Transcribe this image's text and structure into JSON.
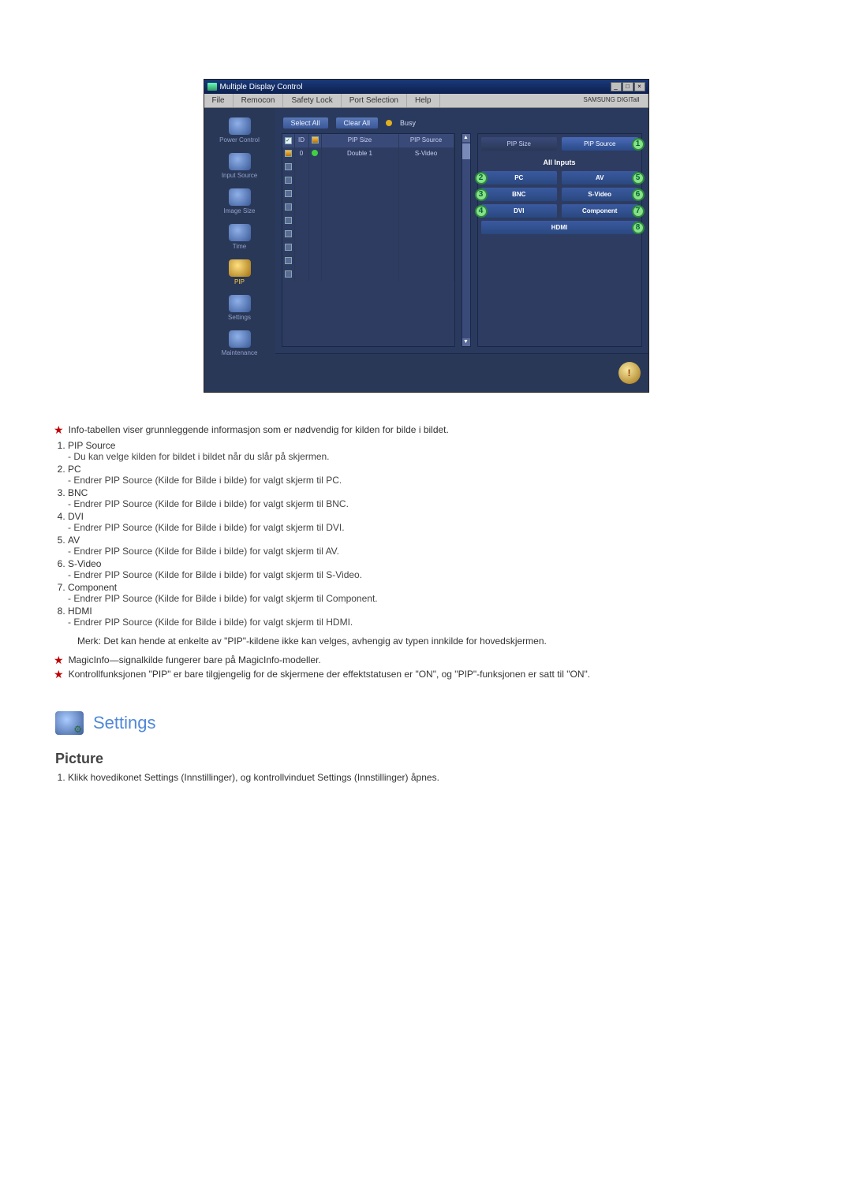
{
  "app": {
    "title": "Multiple Display Control",
    "menus": [
      "File",
      "Remocon",
      "Safety Lock",
      "Port Selection",
      "Help"
    ],
    "brand": "SAMSUNG DIGITall"
  },
  "sidebar": {
    "items": [
      {
        "label": "Power Control"
      },
      {
        "label": "Input Source"
      },
      {
        "label": "Image Size"
      },
      {
        "label": "Time"
      },
      {
        "label": "PIP",
        "active": true
      },
      {
        "label": "Settings"
      },
      {
        "label": "Maintenance"
      }
    ]
  },
  "toolbar": {
    "select_all": "Select All",
    "clear_all": "Clear All",
    "busy": "Busy"
  },
  "table": {
    "headers": {
      "chk": "",
      "id": "ID",
      "status": "",
      "size": "PIP Size",
      "source": "PIP Source"
    },
    "row0": {
      "id": "0",
      "size": "Double 1",
      "source": "S-Video"
    }
  },
  "panel": {
    "top_tabs": {
      "size": "PIP Size",
      "source": "PIP Source"
    },
    "all_inputs": "All Inputs",
    "buttons": {
      "pc": "PC",
      "av": "AV",
      "bnc": "BNC",
      "svideo": "S-Video",
      "dvi": "DVI",
      "component": "Component",
      "hdmi": "HDMI"
    },
    "callouts": {
      "c1": "1",
      "c2": "2",
      "c3": "3",
      "c4": "4",
      "c5": "5",
      "c6": "6",
      "c7": "7",
      "c8": "8"
    }
  },
  "explain": {
    "intro": "Info-tabellen viser grunnleggende informasjon som er nødvendig for kilden for bilde i bildet.",
    "items": [
      {
        "h": "PIP Source",
        "d": "- Du kan velge kilden for bildet i bildet når du slår på skjermen."
      },
      {
        "h": "PC",
        "d": "- Endrer PIP Source (Kilde for Bilde i bilde) for valgt skjerm til PC."
      },
      {
        "h": "BNC",
        "d": "- Endrer PIP Source (Kilde for Bilde i bilde) for valgt skjerm til BNC."
      },
      {
        "h": "DVI",
        "d": "- Endrer PIP Source (Kilde for Bilde i bilde) for valgt skjerm til DVI."
      },
      {
        "h": "AV",
        "d": "- Endrer PIP Source (Kilde for Bilde i bilde) for valgt skjerm til AV."
      },
      {
        "h": "S-Video",
        "d": "- Endrer PIP Source (Kilde for Bilde i bilde) for valgt skjerm til S-Video."
      },
      {
        "h": "Component",
        "d": "- Endrer PIP Source (Kilde for Bilde i bilde) for valgt skjerm til Component."
      },
      {
        "h": "HDMI",
        "d": "- Endrer PIP Source (Kilde for Bilde i bilde) for valgt skjerm til HDMI."
      }
    ],
    "note": "Merk: Det kan hende at enkelte av \"PIP\"-kildene ikke kan velges, avhengig av typen innkilde for hovedskjermen.",
    "star2": "MagicInfo—signalkilde fungerer bare på MagicInfo-modeller.",
    "star3": "Kontrollfunksjonen \"PIP\" er bare tilgjengelig for de skjermene der effektstatusen er \"ON\", og \"PIP\"-funksjonen er satt til \"ON\"."
  },
  "section": {
    "settings_title": "Settings",
    "picture_title": "Picture",
    "picture_step1": "Klikk hovedikonet Settings (Innstillinger), og kontrollvinduet Settings (Innstillinger) åpnes."
  }
}
